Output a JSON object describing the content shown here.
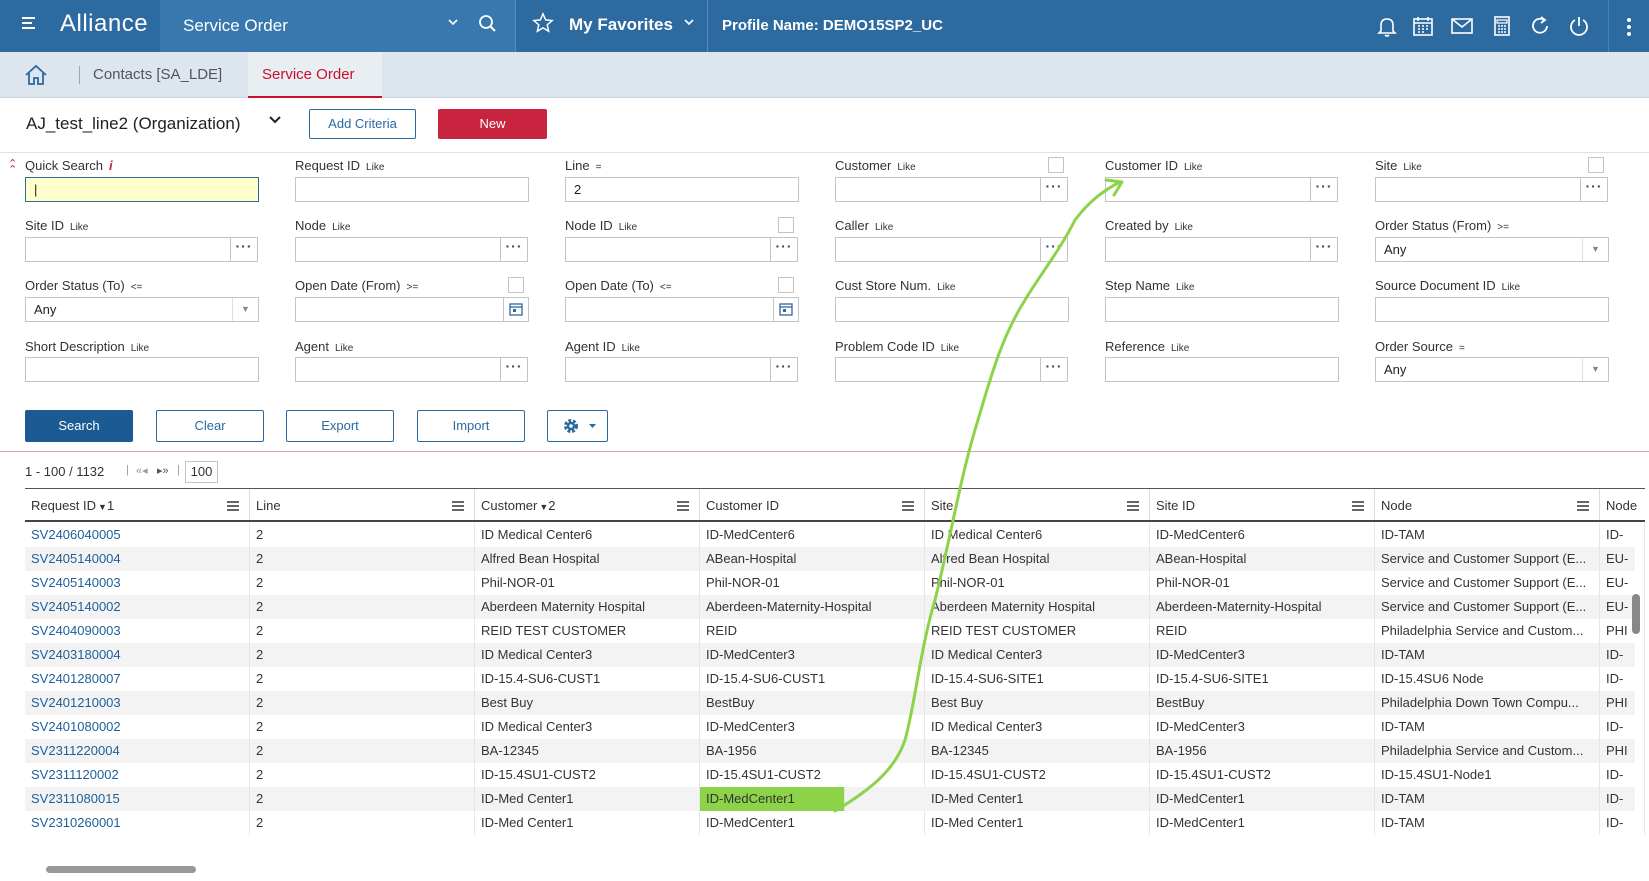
{
  "topbar": {
    "brand": "Alliance",
    "app_title": "Service Order",
    "favorites_label": "My Favorites",
    "profile_label": "Profile Name: DEMO15SP2_UC"
  },
  "breadcrumb": {
    "items": [
      "Contacts [SA_LDE]",
      "Service Order"
    ]
  },
  "view": {
    "title": "AJ_test_line2 (Organization)",
    "add_criteria_label": "Add Criteria",
    "new_label": "New"
  },
  "filters": {
    "quick_search": {
      "label": "Quick Search",
      "info": "i",
      "value": "|"
    },
    "request_id": {
      "label": "Request ID",
      "op": "Like"
    },
    "line": {
      "label": "Line",
      "op": "=",
      "value": "2"
    },
    "customer": {
      "label": "Customer",
      "op": "Like"
    },
    "customer_id": {
      "label": "Customer ID",
      "op": "Like"
    },
    "site": {
      "label": "Site",
      "op": "Like"
    },
    "site_id": {
      "label": "Site ID",
      "op": "Like"
    },
    "node": {
      "label": "Node",
      "op": "Like"
    },
    "node_id": {
      "label": "Node ID",
      "op": "Like"
    },
    "caller": {
      "label": "Caller",
      "op": "Like"
    },
    "created_by": {
      "label": "Created by",
      "op": "Like"
    },
    "order_status_from": {
      "label": "Order Status (From)",
      "op": ">=",
      "value": "Any"
    },
    "order_status_to": {
      "label": "Order Status (To)",
      "op": "<=",
      "value": "Any"
    },
    "open_date_from": {
      "label": "Open Date (From)",
      "op": ">="
    },
    "open_date_to": {
      "label": "Open Date (To)",
      "op": "<="
    },
    "cust_store_num": {
      "label": "Cust Store Num.",
      "op": "Like"
    },
    "step_name": {
      "label": "Step Name",
      "op": "Like"
    },
    "source_document_id": {
      "label": "Source Document ID",
      "op": "Like"
    },
    "short_description": {
      "label": "Short Description",
      "op": "Like"
    },
    "agent": {
      "label": "Agent",
      "op": "Like"
    },
    "agent_id": {
      "label": "Agent ID",
      "op": "Like"
    },
    "problem_code_id": {
      "label": "Problem Code ID",
      "op": "Like"
    },
    "reference": {
      "label": "Reference",
      "op": "Like"
    },
    "order_source": {
      "label": "Order Source",
      "op": "=",
      "value": "Any"
    }
  },
  "actions": {
    "search": "Search",
    "clear": "Clear",
    "export": "Export",
    "import": "Import"
  },
  "pager": {
    "range": "1 - 100 / 1132",
    "page_size": "100"
  },
  "grid": {
    "columns": [
      {
        "label": "Request ID",
        "sort": "1"
      },
      {
        "label": "Line"
      },
      {
        "label": "Customer",
        "sort": "2"
      },
      {
        "label": "Customer ID"
      },
      {
        "label": "Site"
      },
      {
        "label": "Site ID"
      },
      {
        "label": "Node"
      },
      {
        "label": "Node"
      }
    ],
    "rows": [
      [
        "SV2406040005",
        "2",
        "ID Medical Center6",
        "ID-MedCenter6",
        "ID Medical Center6",
        "ID-MedCenter6",
        "ID-TAM",
        "ID-"
      ],
      [
        "SV2405140004",
        "2",
        "Alfred Bean Hospital",
        "ABean-Hospital",
        "Alfred Bean Hospital",
        "ABean-Hospital",
        "Service and Customer Support (E...",
        "EU-"
      ],
      [
        "SV2405140003",
        "2",
        "Phil-NOR-01",
        "Phil-NOR-01",
        "Phil-NOR-01",
        "Phil-NOR-01",
        "Service and Customer Support (E...",
        "EU-"
      ],
      [
        "SV2405140002",
        "2",
        "Aberdeen Maternity Hospital",
        "Aberdeen-Maternity-Hospital",
        "Aberdeen Maternity Hospital",
        "Aberdeen-Maternity-Hospital",
        "Service and Customer Support (E...",
        "EU-"
      ],
      [
        "SV2404090003",
        "2",
        "REID TEST CUSTOMER",
        "REID",
        "REID TEST CUSTOMER",
        "REID",
        "Philadelphia Service and Custom...",
        "PHI"
      ],
      [
        "SV2403180004",
        "2",
        "ID Medical Center3",
        "ID-MedCenter3",
        "ID Medical Center3",
        "ID-MedCenter3",
        "ID-TAM",
        "ID-"
      ],
      [
        "SV2401280007",
        "2",
        "ID-15.4-SU6-CUST1",
        "ID-15.4-SU6-CUST1",
        "ID-15.4-SU6-SITE1",
        "ID-15.4-SU6-SITE1",
        "ID-15.4SU6 Node",
        "ID-"
      ],
      [
        "SV2401210003",
        "2",
        "Best Buy",
        "BestBuy",
        "Best Buy",
        "BestBuy",
        "Philadelphia Down Town Compu...",
        "PHI"
      ],
      [
        "SV2401080002",
        "2",
        "ID Medical Center3",
        "ID-MedCenter3",
        "ID Medical Center3",
        "ID-MedCenter3",
        "ID-TAM",
        "ID-"
      ],
      [
        "SV2311220004",
        "2",
        "BA-12345",
        "BA-1956",
        "BA-12345",
        "BA-1956",
        "Philadelphia Service and Custom...",
        "PHI"
      ],
      [
        "SV2311120002",
        "2",
        "ID-15.4SU1-CUST2",
        "ID-15.4SU1-CUST2",
        "ID-15.4SU1-CUST2",
        "ID-15.4SU1-CUST2",
        "ID-15.4SU1-Node1",
        "ID-"
      ],
      [
        "SV2311080015",
        "2",
        "ID-Med Center1",
        "ID-MedCenter1",
        "ID-Med Center1",
        "ID-MedCenter1",
        "ID-TAM",
        "ID-"
      ],
      [
        "SV2310260001",
        "2",
        "ID-Med Center1",
        "ID-MedCenter1",
        "ID-Med Center1",
        "ID-MedCenter1",
        "ID-TAM",
        "ID-"
      ]
    ],
    "highlight_color": "#8dd34a"
  }
}
